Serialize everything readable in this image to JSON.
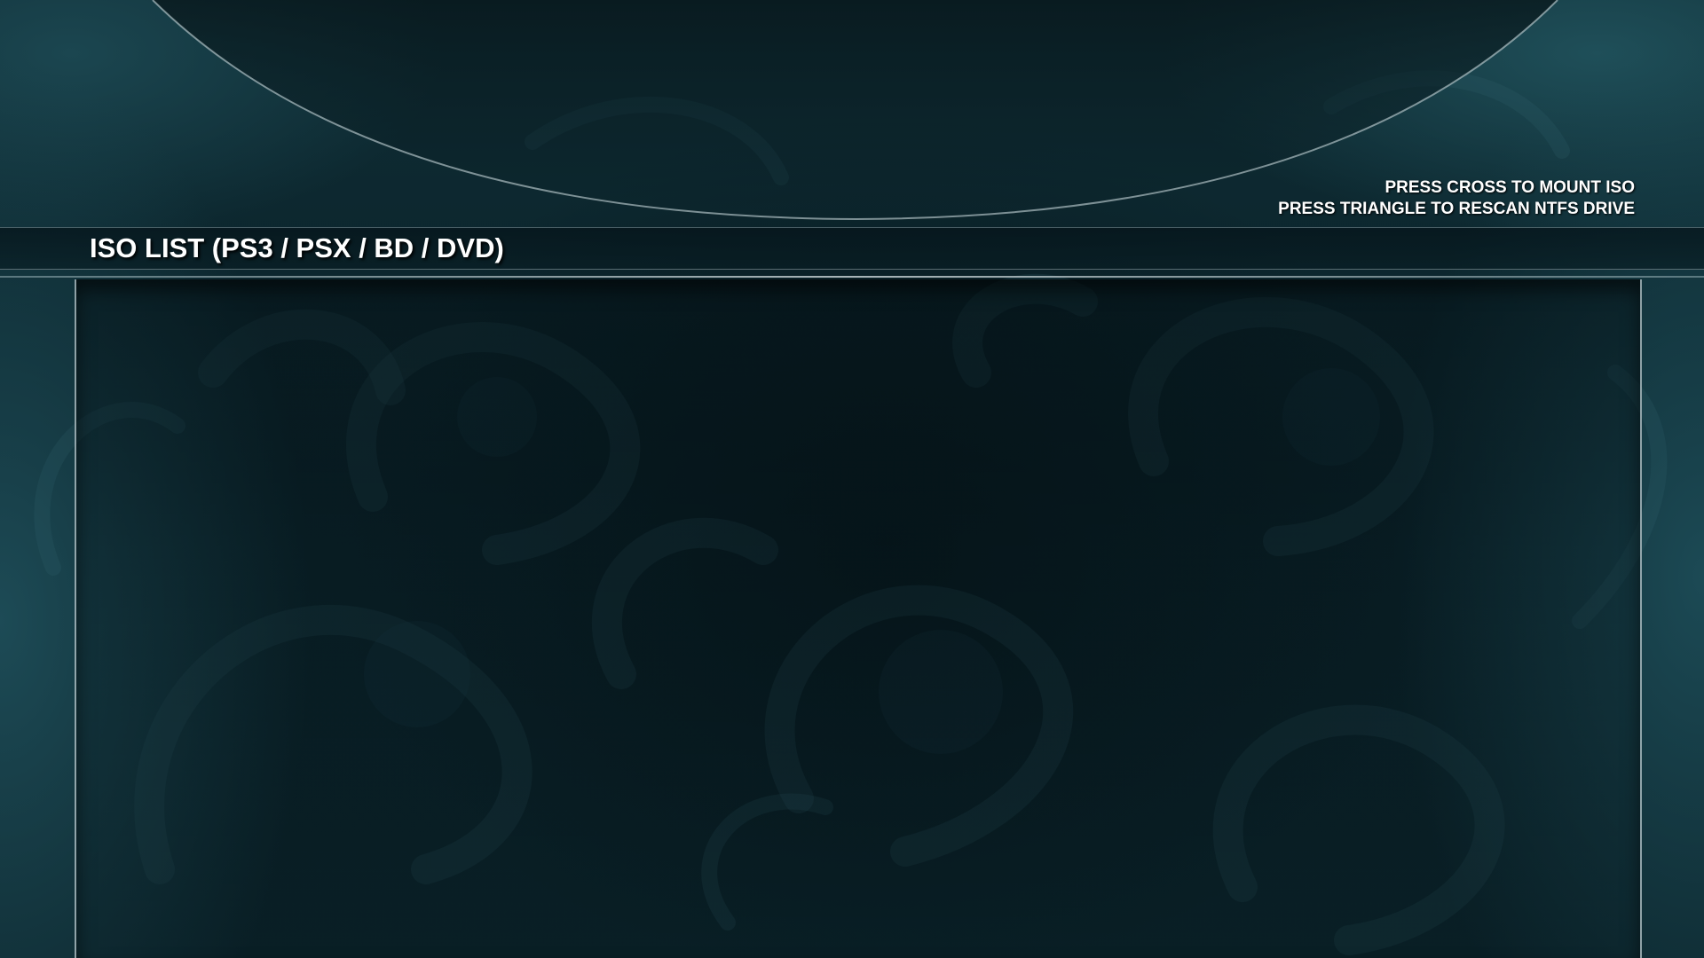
{
  "header": {
    "title": "ISO LIST (PS3 / PSX / BD / DVD)"
  },
  "hints": {
    "line1": "PRESS CROSS TO MOUNT ISO",
    "line2": "PRESS TRIANGLE TO RESCAN NTFS DRIVE"
  },
  "iso_list": {
    "items": []
  },
  "colors": {
    "background": "#0b2229",
    "accent": "#1d4b56",
    "text": "#ffffff",
    "border": "#c8d7dc"
  }
}
